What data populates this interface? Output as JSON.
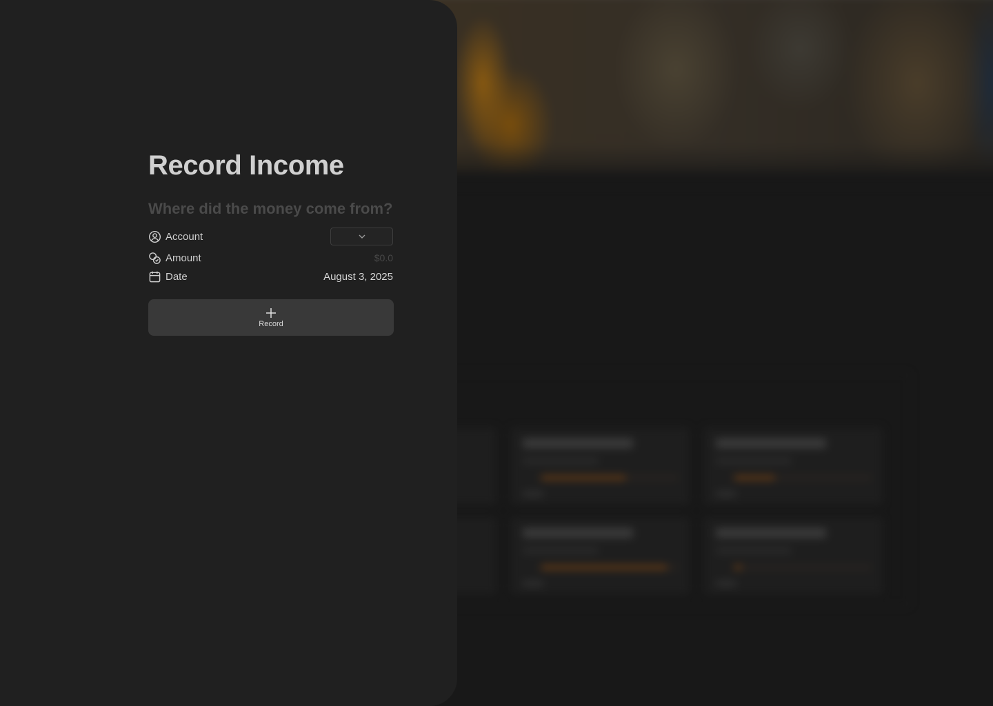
{
  "panel": {
    "title": "Record Income",
    "subtitle": "Where did the money come from?",
    "properties": [
      {
        "label": "Account",
        "icon": "user-circle-icon",
        "value": "",
        "kind": "dropdown"
      },
      {
        "label": "Amount",
        "icon": "coins-icon",
        "value": "$0.0",
        "kind": "placeholder"
      },
      {
        "label": "Date",
        "icon": "calendar-icon",
        "value": "August 3, 2025",
        "kind": "value"
      }
    ],
    "record_button": {
      "label": "Record",
      "icon": "plus-icon"
    }
  },
  "colors": {
    "panel_bg": "#202020",
    "title": "#d0d0d0",
    "subtitle": "#4a4a4a",
    "button_bg": "#393939",
    "accent_orange": "#6e3e14"
  },
  "background": {
    "blurred": true,
    "cards": [
      {
        "progress": 0.62
      },
      {
        "progress": 0.3
      },
      {
        "progress": 0.92
      },
      {
        "progress": 0.06
      }
    ]
  }
}
